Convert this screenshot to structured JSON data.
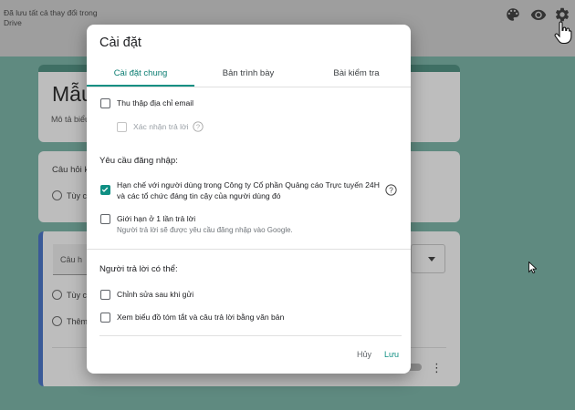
{
  "header": {
    "saved_status": "Đã lưu tất cả thay đổi trong Drive",
    "icons": [
      "palette-icon",
      "eye-icon",
      "gear-icon"
    ]
  },
  "form": {
    "title": "Mẫu",
    "description": "Mô tả biểu",
    "question1": {
      "title": "Câu hỏi k",
      "option": "Tùy c"
    },
    "question2": {
      "input_placeholder": "Câu h",
      "option": "Tùy c",
      "add_option": "Thêm"
    }
  },
  "dialog": {
    "title": "Cài đặt",
    "tabs": [
      "Cài đặt chung",
      "Bản trình bày",
      "Bài kiểm tra"
    ],
    "active_tab": 0,
    "collect_email": {
      "label": "Thu thập địa chỉ email",
      "checked": false
    },
    "response_receipts": {
      "label": "Xác nhận trả lời",
      "checked": false,
      "disabled": true
    },
    "requires_signin_heading": "Yêu cầu đăng nhập:",
    "restrict_users": {
      "label_line1": "Hạn chế với người dùng trong Công ty Cổ phần Quảng cáo Trực tuyến 24H",
      "label_line2": "và các tổ chức đáng tin cậy của người dùng đó",
      "checked": true
    },
    "limit_one_response": {
      "label": "Giới hạn ở 1 lần trả lời",
      "sublabel": "Người trả lời sẽ được yêu cầu đăng nhập vào Google.",
      "checked": false
    },
    "respondents_can_heading": "Người trả lời có thể:",
    "edit_after_submit": {
      "label": "Chỉnh sửa sau khi gửi",
      "checked": false
    },
    "see_summary": {
      "label": "Xem biểu đồ tóm tắt và câu trả lời bằng văn bản",
      "checked": false
    },
    "cancel_label": "Hủy",
    "save_label": "Lưu"
  },
  "colors": {
    "accent": "#0f8f83",
    "overlay_background": "#5f8a80",
    "question_left_border": "#3a5a98"
  }
}
